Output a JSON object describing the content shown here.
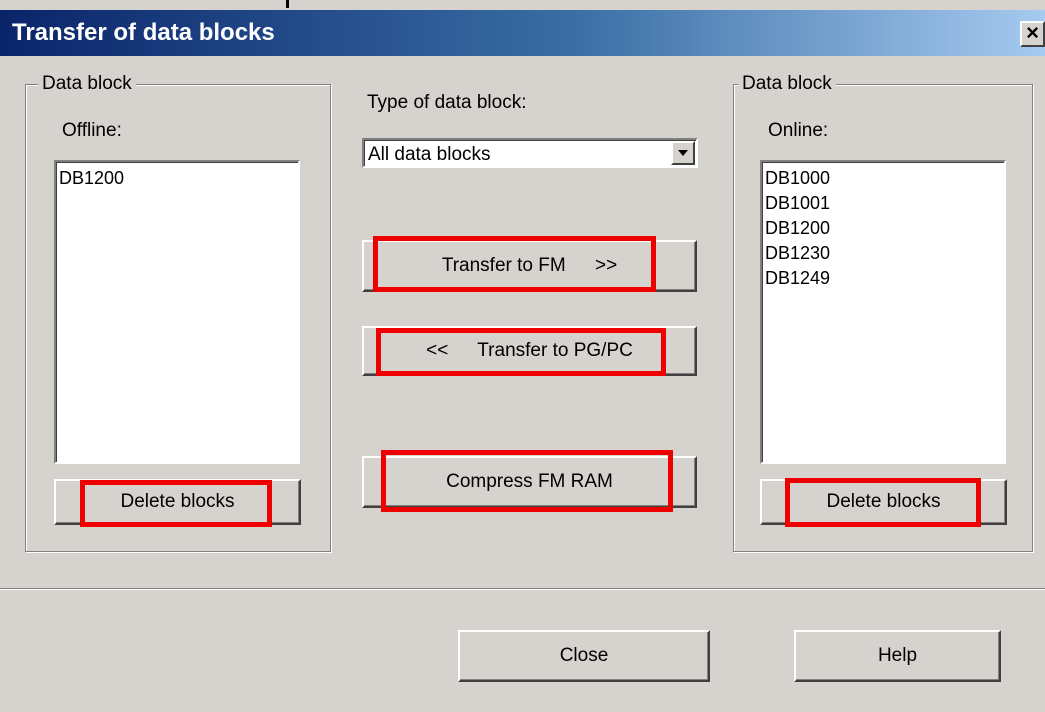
{
  "window": {
    "title": "Transfer of data blocks",
    "close_glyph": "×"
  },
  "offline_group": {
    "legend": "Data block",
    "label": "Offline:",
    "items": [
      "DB1200"
    ],
    "delete_label": "Delete blocks"
  },
  "online_group": {
    "legend": "Data block",
    "label": "Online:",
    "items": [
      "DB1000",
      "DB1001",
      "DB1200",
      "DB1230",
      "DB1249"
    ],
    "delete_label": "Delete blocks"
  },
  "type_select": {
    "label": "Type of data block:",
    "selected": "All data blocks"
  },
  "actions": {
    "transfer_to_fm": "Transfer to FM",
    "transfer_to_fm_arrows": ">>",
    "transfer_to_pg": "Transfer to PG/PC",
    "transfer_to_pg_arrows": "<<",
    "compress": "Compress FM RAM"
  },
  "footer": {
    "close_label": "Close",
    "help_label": "Help"
  },
  "colors": {
    "highlight": "#ee0000",
    "dialog_bg": "#d6d3ce",
    "title_start": "#0a246a",
    "title_end": "#a6caf0"
  },
  "icons": {
    "dropdown": "chevron-down-icon",
    "close": "close-icon"
  }
}
